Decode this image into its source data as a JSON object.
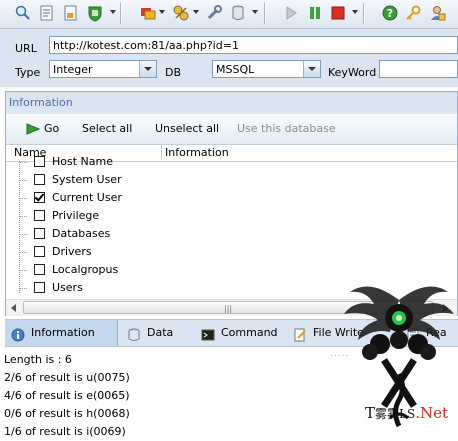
{
  "toolbar": {
    "icons": [
      "search-icon",
      "page-icon",
      "export-icon",
      "green-shield-icon",
      "flag-icon",
      "puzzle-icon",
      "wrench-icon",
      "database-icon",
      "play-icon",
      "pause-icon",
      "stop-icon",
      "help-icon",
      "key-icon",
      "user-icon"
    ]
  },
  "form": {
    "url_label": "URL",
    "url_value": "http://kotest.com:81/aa.php?id=1",
    "type_label": "Type",
    "type_value": "Integer",
    "db_label": "DB",
    "db_value": "MSSQL",
    "keyword_label": "KeyWord",
    "keyword_value": ""
  },
  "panel": {
    "title": "Information",
    "go_label": "Go",
    "select_all": "Select all",
    "unselect_all": "Unselect all",
    "use_db": "Use this database",
    "col_name": "Name",
    "col_info": "Information",
    "items": [
      {
        "label": "Host Name",
        "checked": false
      },
      {
        "label": "System User",
        "checked": false
      },
      {
        "label": "Current User",
        "checked": true
      },
      {
        "label": "Privilege",
        "checked": false
      },
      {
        "label": "Databases",
        "checked": false
      },
      {
        "label": "Drivers",
        "checked": false
      },
      {
        "label": "Localgropus",
        "checked": false
      },
      {
        "label": "Users",
        "checked": false
      }
    ]
  },
  "tabs": [
    {
      "label": "Information",
      "icon": "info-icon",
      "active": true
    },
    {
      "label": "Data",
      "icon": "database-icon",
      "active": false
    },
    {
      "label": "Command",
      "icon": "terminal-icon",
      "active": false
    },
    {
      "label": "File Write",
      "icon": "file-write-icon",
      "active": false
    },
    {
      "label": "Rea",
      "icon": "reader-icon",
      "active": false
    }
  ],
  "log": [
    "Length is : 6",
    "2/6 of result is u(0075)",
    "4/6 of result is e(0065)",
    "0/6 of result is h(0068)",
    "1/6 of result is i(0069)"
  ],
  "watermark": {
    "brand_t": "T",
    "brand_mid": "雾雾LS",
    "brand_dot": ".",
    "brand_net": "Net"
  },
  "colors": {
    "accent": "#4a6fa5",
    "panel_bg": "#dbe5f1",
    "tab_active": "#c4d6ec",
    "brand_red": "#d0281c"
  }
}
